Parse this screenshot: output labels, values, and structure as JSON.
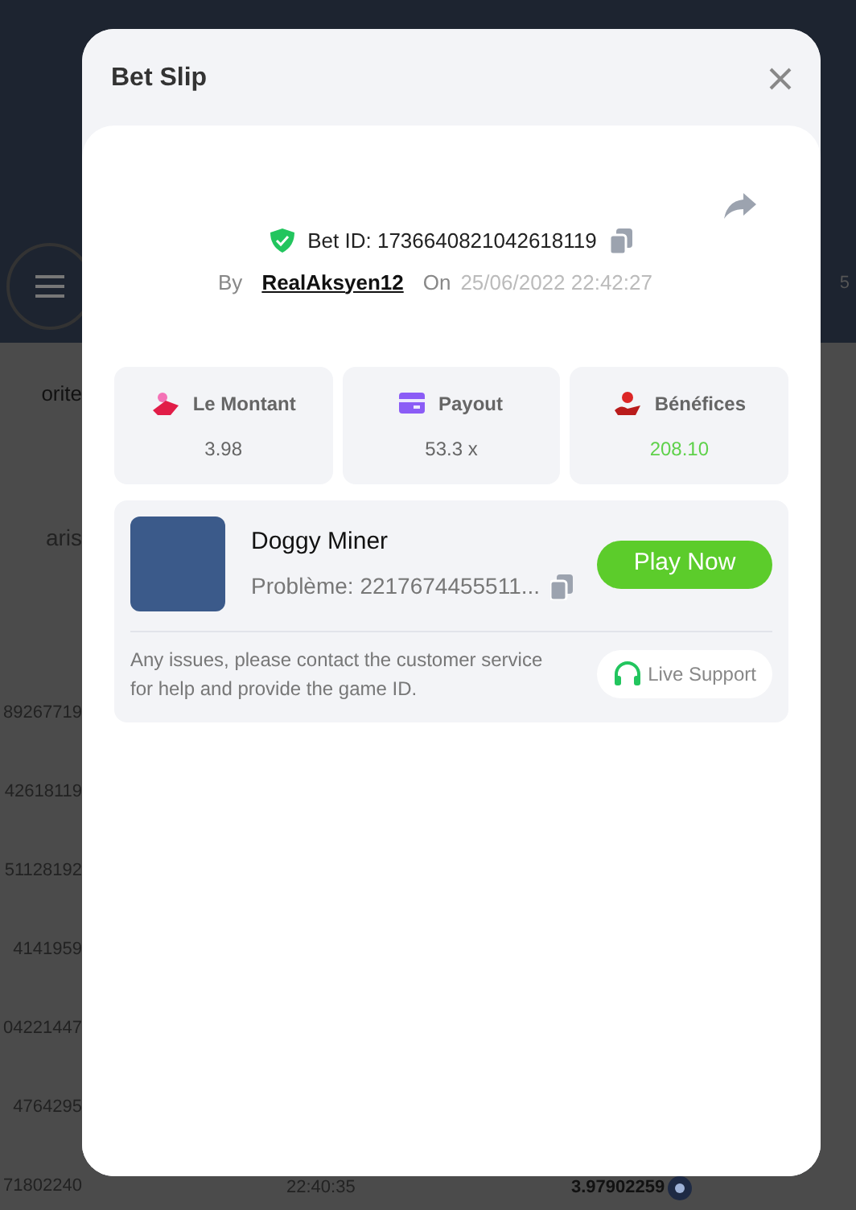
{
  "background": {
    "banner_fragment": "5",
    "search_fragment": "orite",
    "tab_fragment": "aris",
    "rows": [
      "89267719",
      "42618119",
      "51128192",
      "4141959",
      "04221447",
      "4764295",
      "71802240"
    ],
    "last_row": {
      "time": "22:40:35",
      "amount": "3.97902259"
    }
  },
  "modal": {
    "title": "Bet Slip",
    "bet_id": "Bet ID: 1736640821042618119",
    "by_label": "By",
    "user": "RealAksyen12",
    "on_label": "On",
    "datetime": "25/06/2022 22:42:27",
    "stats": [
      {
        "kind": "amount",
        "label": "Le Montant",
        "value": "3.98",
        "positive": false
      },
      {
        "kind": "payout",
        "label": "Payout",
        "value": "53.3 x",
        "positive": false
      },
      {
        "kind": "profit",
        "label": "Bénéfices",
        "value": "208.10",
        "positive": true
      }
    ],
    "game": {
      "name": "Doggy Miner",
      "problem": "Problème: 2217674455511...",
      "play_button": "Play Now"
    },
    "notice": "Any issues, please contact the customer service for help and provide the game ID.",
    "support_button": "Live Support"
  }
}
